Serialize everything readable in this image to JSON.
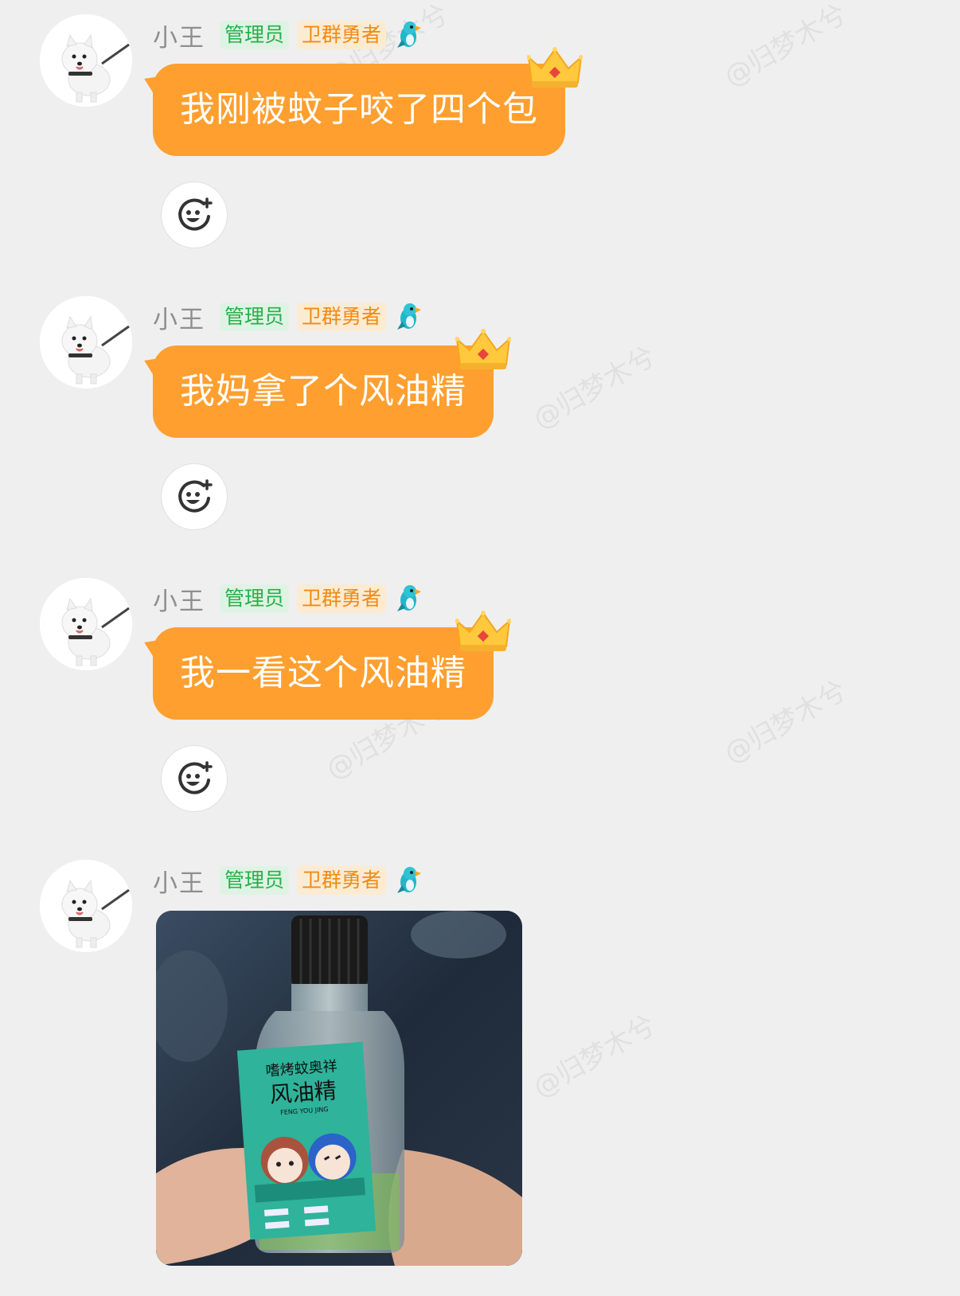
{
  "watermark": "@归梦木兮",
  "messages": [
    {
      "name": "小王",
      "badges": {
        "admin": "管理员",
        "hero": "卫群勇者"
      },
      "text": "我刚被蚊子咬了四个包"
    },
    {
      "name": "小王",
      "badges": {
        "admin": "管理员",
        "hero": "卫群勇者"
      },
      "text": "我妈拿了个风油精"
    },
    {
      "name": "小王",
      "badges": {
        "admin": "管理员",
        "hero": "卫群勇者"
      },
      "text": "我一看这个风油精"
    },
    {
      "name": "小王",
      "badges": {
        "admin": "管理员",
        "hero": "卫群勇者"
      },
      "image": {
        "label_line1": "嗜烤蚊奥祥",
        "label_line2": "风油精",
        "label_line3": "FENG YOU JING"
      }
    }
  ],
  "icons": {
    "avatar": "samoyed-dog-avatar",
    "level_badge": "parrot-icon",
    "bubble_decoration": "crown-icon",
    "reaction": "add-emoji-icon"
  },
  "colors": {
    "background": "#efefef",
    "bubble": "#fe9f2f",
    "admin_badge": "#27b04a",
    "hero_badge": "#f28a12"
  }
}
